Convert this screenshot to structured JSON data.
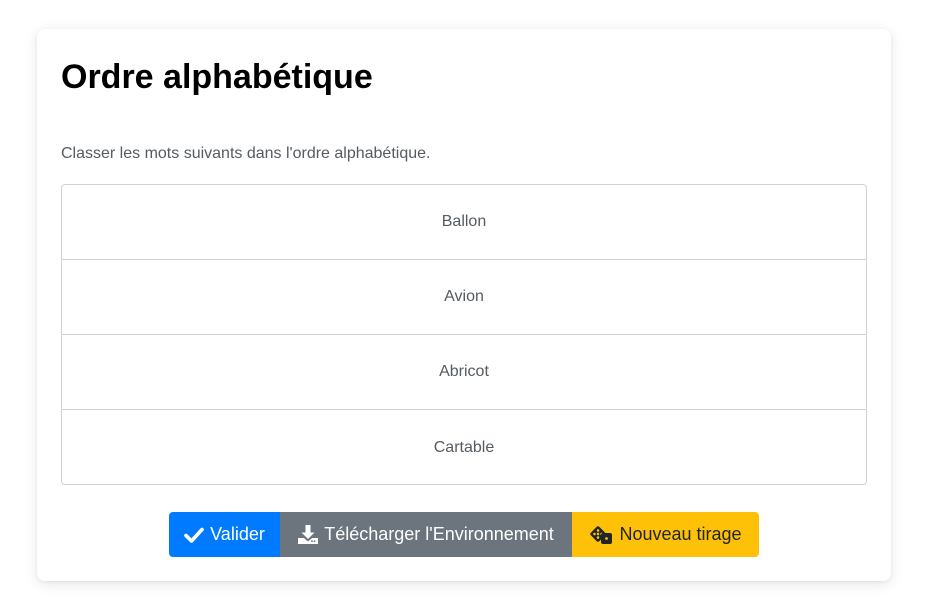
{
  "page": {
    "title": "Ordre alphabétique",
    "instruction": "Classer les mots suivants dans l'ordre alphabétique."
  },
  "words": [
    {
      "label": "Ballon"
    },
    {
      "label": "Avion"
    },
    {
      "label": "Abricot"
    },
    {
      "label": "Cartable"
    }
  ],
  "buttons": {
    "validate": {
      "label": "Valider",
      "icon": "check-icon",
      "color": "#007bff"
    },
    "download": {
      "label": "Télécharger l'Environnement",
      "icon": "download-icon",
      "color": "#6c757d"
    },
    "new_draw": {
      "label": "Nouveau tirage",
      "icon": "dice-icon",
      "color": "#ffc107"
    }
  }
}
